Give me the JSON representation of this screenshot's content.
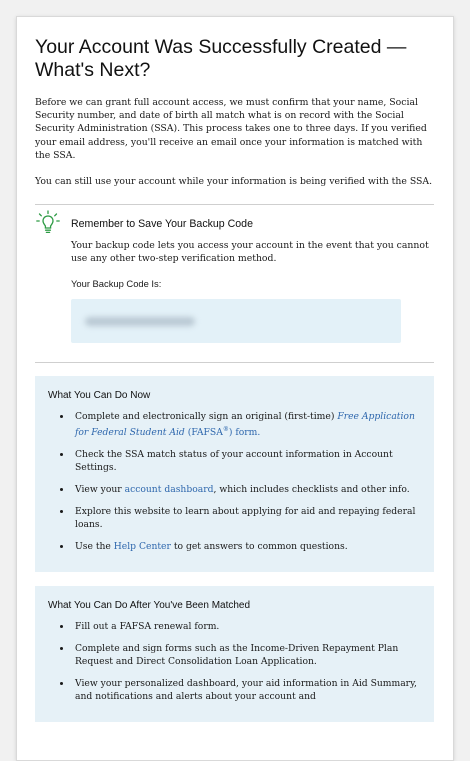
{
  "title": "Your Account Was Successfully Created — What's Next?",
  "intro": {
    "p1": "Before we can grant full account access, we must confirm that your name, Social Security number, and date of birth all match what is on record with the Social Security Administration (SSA). This process takes one to three days. If you verified your email address, you'll receive an email once your information is matched with the SSA.",
    "p2": "You can still use your account while your information is being verified with the SSA."
  },
  "backup": {
    "icon": "lightbulb-icon",
    "heading": "Remember to Save Your Backup Code",
    "text": "Your backup code lets you access your account in the event that you cannot use any other two-step verification method.",
    "code_label": "Your Backup Code Is:"
  },
  "now": {
    "title": "What You Can Do Now",
    "item1": {
      "pre": "Complete and electronically sign an original (first-time) ",
      "link": "Free Application for Federal Student Aid",
      "mid": " (FAFSA",
      "sup": "®",
      "post": ") form."
    },
    "item2": "Check the SSA match status of your account information in Account Settings.",
    "item3": {
      "pre": "View your ",
      "link": "account dashboard",
      "post": ", which includes checklists and other info."
    },
    "item4": "Explore this website to learn about applying for aid and repaying federal loans.",
    "item5": {
      "pre": "Use the ",
      "link": "Help Center",
      "post": " to get answers to common questions."
    }
  },
  "after": {
    "title": "What You Can Do After You've Been Matched",
    "items": [
      "Fill out a FAFSA renewal form.",
      "Complete and sign forms such as the Income-Driven Repayment Plan Request and Direct Consolidation Loan Application.",
      "View your personalized dashboard, your aid information in Aid Summary, and notifications and alerts about your account and"
    ]
  },
  "colors": {
    "panel_bg": "#e6f1f7",
    "link": "#2e67ad",
    "icon": "#2e9b45"
  }
}
